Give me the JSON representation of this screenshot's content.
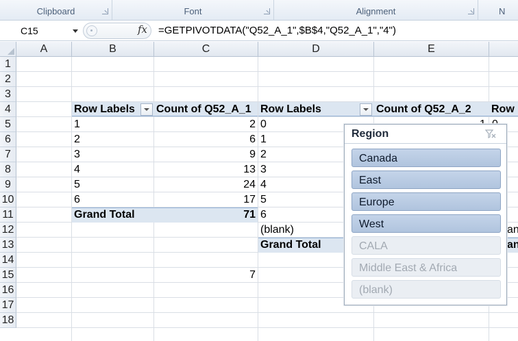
{
  "ribbon": {
    "groups": [
      {
        "label": "Clipboard"
      },
      {
        "label": "Font"
      },
      {
        "label": "Alignment"
      },
      {
        "label": "N"
      }
    ]
  },
  "formula_bar": {
    "name_box": "C15",
    "fx_label": "fx",
    "formula": "=GETPIVOTDATA(\"Q52_A_1\",$B$4,\"Q52_A_1\",\"4\")"
  },
  "columns": [
    "A",
    "B",
    "C",
    "D",
    "E"
  ],
  "rows": [
    "1",
    "2",
    "3",
    "4",
    "5",
    "6",
    "7",
    "8",
    "9",
    "10",
    "11",
    "12",
    "13",
    "14",
    "15",
    "16",
    "17",
    "18"
  ],
  "pivot1": {
    "row_labels_header": "Row Labels",
    "count_header": "Count of Q52_A_1",
    "rows": [
      {
        "label": "1",
        "count": "2"
      },
      {
        "label": "2",
        "count": "6"
      },
      {
        "label": "3",
        "count": "9"
      },
      {
        "label": "4",
        "count": "13"
      },
      {
        "label": "5",
        "count": "24"
      },
      {
        "label": "6",
        "count": "17"
      }
    ],
    "grand_total_label": "Grand Total",
    "grand_total_value": "71"
  },
  "pivot2": {
    "row_labels_header": "Row Labels",
    "count_header": "Count of Q52_A_2",
    "rows": [
      "0",
      "1",
      "2",
      "3",
      "4",
      "5",
      "6",
      "(blank)"
    ],
    "grand_total_label": "Grand Total",
    "partial_first_value": "1",
    "partial_zero": "0"
  },
  "pivot3": {
    "header_partial": "Row",
    "row12_partial": "ank",
    "row13_partial": "an"
  },
  "c15_value": "7",
  "slicer": {
    "title": "Region",
    "items": [
      {
        "label": "Canada",
        "selected": true
      },
      {
        "label": "East",
        "selected": true
      },
      {
        "label": "Europe",
        "selected": true
      },
      {
        "label": "West",
        "selected": true
      },
      {
        "label": "CALA",
        "selected": false
      },
      {
        "label": "Middle East & Africa",
        "selected": false
      },
      {
        "label": "(blank)",
        "selected": false
      }
    ]
  }
}
